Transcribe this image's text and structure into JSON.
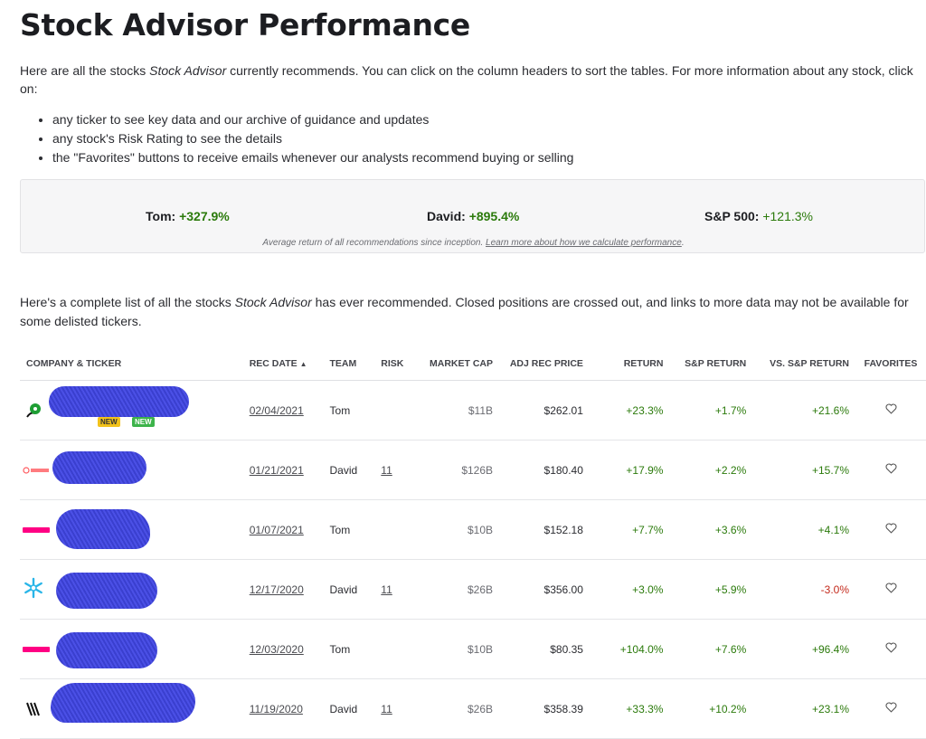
{
  "page": {
    "title": "Stock Advisor Performance",
    "intro_before": "Here are all the stocks ",
    "intro_em": "Stock Advisor",
    "intro_after": " currently recommends. You can click on the column headers to sort the tables. For more information about any stock, click on:",
    "bullets": [
      "any ticker to see key data and our archive of guidance and updates",
      "any stock's Risk Rating to see the details",
      "the \"Favorites\" buttons to receive emails whenever our analysts recommend buying or selling"
    ]
  },
  "performance": {
    "tom_label": "Tom: ",
    "tom_value": "+327.9%",
    "david_label": "David: ",
    "david_value": "+895.4%",
    "sp_label": "S&P 500: ",
    "sp_value": "+121.3%",
    "note_text": "Average return of all recommendations since inception. ",
    "note_link": "Learn more about how we calculate performance",
    "note_end": "."
  },
  "list_intro": {
    "before": "Here's a complete list of all the stocks ",
    "em": "Stock Advisor",
    "after": " has ever recommended. Closed positions are crossed out, and links to more data may not be available for some delisted tickers."
  },
  "table": {
    "headers": {
      "company": "Company & Ticker",
      "rec_date": "Rec Date",
      "team": "Team",
      "risk": "Risk",
      "market_cap": "Market Cap",
      "adj_rec_price": "Adj Rec Price",
      "return": "Return",
      "sp_return": "S&P Return",
      "vs_sp_return": "vs. S&P Return",
      "favorites": "Favorites"
    },
    "sort_indicator": "▲",
    "rows": [
      {
        "logo": "green-circle-logo",
        "rec_date": "02/04/2021",
        "team": "Tom",
        "risk": "",
        "market_cap": "$11B",
        "adj_rec_price": "$262.01",
        "return": "+23.3%",
        "sp_return": "+1.7%",
        "vs_sp_return": "+21.6%",
        "vs_sp_color": "green"
      },
      {
        "logo": "airbnb-logo",
        "rec_date": "01/21/2021",
        "team": "David",
        "risk": "11",
        "market_cap": "$126B",
        "adj_rec_price": "$180.40",
        "return": "+17.9%",
        "sp_return": "+2.2%",
        "vs_sp_return": "+15.7%",
        "vs_sp_color": "green"
      },
      {
        "logo": "lemonade-logo",
        "rec_date": "01/07/2021",
        "team": "Tom",
        "risk": "",
        "market_cap": "$10B",
        "adj_rec_price": "$152.18",
        "return": "+7.7%",
        "sp_return": "+3.6%",
        "vs_sp_return": "+4.1%",
        "vs_sp_color": "green"
      },
      {
        "logo": "snowflake-logo",
        "rec_date": "12/17/2020",
        "team": "David",
        "risk": "11",
        "market_cap": "$26B",
        "adj_rec_price": "$356.00",
        "return": "+3.0%",
        "sp_return": "+5.9%",
        "vs_sp_return": "-3.0%",
        "vs_sp_color": "red"
      },
      {
        "logo": "lemonade-logo",
        "rec_date": "12/03/2020",
        "team": "Tom",
        "risk": "",
        "market_cap": "$10B",
        "adj_rec_price": "$80.35",
        "return": "+104.0%",
        "sp_return": "+7.6%",
        "vs_sp_return": "+96.4%",
        "vs_sp_color": "green"
      },
      {
        "logo": "zebra-logo",
        "rec_date": "11/19/2020",
        "team": "David",
        "risk": "11",
        "market_cap": "$26B",
        "adj_rec_price": "$358.39",
        "return": "+33.3%",
        "sp_return": "+10.2%",
        "vs_sp_return": "+23.1%",
        "vs_sp_color": "green"
      }
    ]
  },
  "colors": {
    "positive": "#2b7a0b",
    "negative": "#c42a1c",
    "redaction": "#4047d8"
  },
  "icons": {
    "favorite": "heart-outline-icon"
  }
}
